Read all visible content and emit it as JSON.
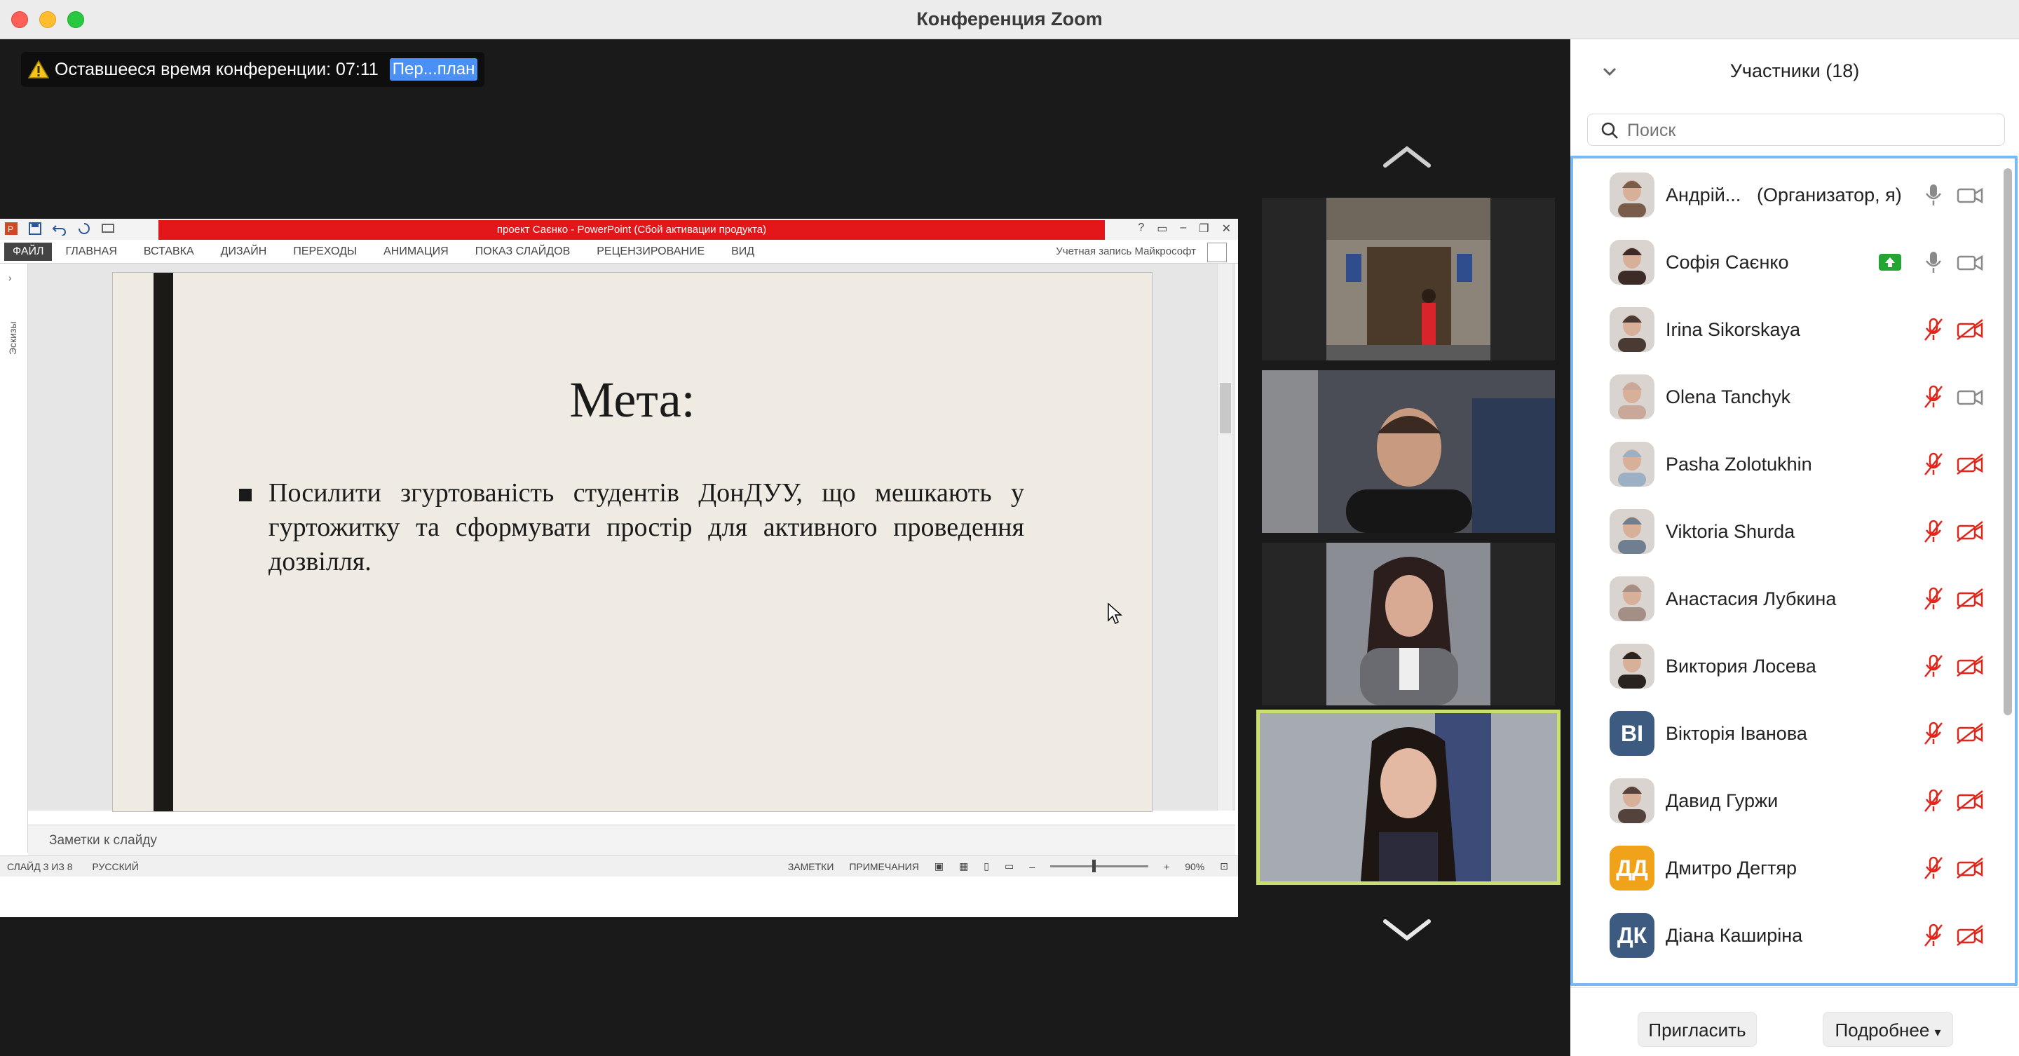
{
  "window": {
    "title": "Конференция Zoom"
  },
  "banner": {
    "time_text": "Оставшееся время конференции: 07:11",
    "link_text": "Пер...план"
  },
  "ppt": {
    "title": "проект Саєнко -  PowerPoint (Сбой активации продукта)",
    "tabs": [
      "ФАЙЛ",
      "ГЛАВНАЯ",
      "ВСТАВКА",
      "ДИЗАЙН",
      "ПЕРЕХОДЫ",
      "АНИМАЦИЯ",
      "ПОКАЗ СЛАЙДОВ",
      "РЕЦЕНЗИРОВАНИЕ",
      "ВИД"
    ],
    "account": "Учетная запись Майкрософт",
    "thumbs_label": "Эскизы",
    "notes_placeholder": "Заметки к слайду",
    "status": {
      "slide": "СЛАЙД 3 ИЗ 8",
      "language": "РУССКИЙ",
      "notes": "ЗАМЕТКИ",
      "comments": "ПРИМЕЧАНИЯ",
      "zoom": "90%"
    },
    "slide": {
      "title": "Мета:",
      "bullet": "Посилити згуртованість студентів ДонДУУ, що мешкають у гуртожитку та сформувати простір для активного проведення дозвілля."
    }
  },
  "panel": {
    "title": "Участники (18)",
    "search_placeholder": "Поиск",
    "participants": [
      {
        "name": "Андрій...",
        "role": "(Организатор, я)",
        "mic": "on",
        "video": "on"
      },
      {
        "name": "Софія Саєнко",
        "role": "",
        "mic": "on",
        "video": "on",
        "sharing": true
      },
      {
        "name": "Irina Sikorskaya",
        "role": "",
        "mic": "muted",
        "video": "off"
      },
      {
        "name": "Olena Tanchyk",
        "role": "",
        "mic": "muted",
        "video": "on"
      },
      {
        "name": "Pasha Zolotukhin",
        "role": "",
        "mic": "muted",
        "video": "off"
      },
      {
        "name": "Viktoria Shurda",
        "role": "",
        "mic": "muted",
        "video": "off"
      },
      {
        "name": "Анастасия Лубкина",
        "role": "",
        "mic": "muted",
        "video": "off"
      },
      {
        "name": "Виктория Лосева",
        "role": "",
        "mic": "muted",
        "video": "off"
      },
      {
        "name": "Вікторія Іванова",
        "role": "",
        "mic": "muted",
        "video": "off",
        "initials": "ВІ",
        "color": "#3d5a80"
      },
      {
        "name": "Давид Гуржи",
        "role": "",
        "mic": "muted",
        "video": "off"
      },
      {
        "name": "Дмитро Дегтяр",
        "role": "",
        "mic": "muted",
        "video": "off",
        "initials": "ДД",
        "color": "#f0a21b"
      },
      {
        "name": "Діана Каширіна",
        "role": "",
        "mic": "muted",
        "video": "off",
        "initials": "ДК",
        "color": "#3d5a80"
      }
    ],
    "invite_label": "Пригласить",
    "more_label": "Подробнее"
  },
  "colors": {
    "accent": "#7ab8f5",
    "active_speaker": "#c9e06a",
    "muted": "#e0261b",
    "share": "#23a435"
  }
}
